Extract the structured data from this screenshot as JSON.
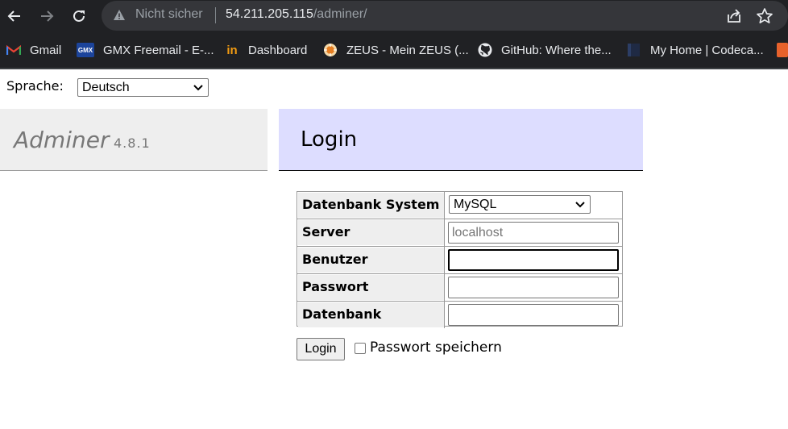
{
  "browser": {
    "security_text": "Nicht sicher",
    "url_host": "54.211.205.115",
    "url_path": "/adminer/",
    "bookmarks": [
      {
        "label": "Gmail",
        "icon": "gmail-icon"
      },
      {
        "label": "GMX Freemail - E-...",
        "icon": "gmx-icon",
        "icon_text": "GMX"
      },
      {
        "label": "Dashboard",
        "icon": "dashboard-icon",
        "icon_text": "in"
      },
      {
        "label": "ZEUS - Mein ZEUS (...",
        "icon": "zeus-icon"
      },
      {
        "label": "GitHub: Where the...",
        "icon": "github-icon"
      },
      {
        "label": "My Home | Codeca...",
        "icon": "codecademy-icon"
      }
    ]
  },
  "page": {
    "language_label": "Sprache:",
    "language_selected": "Deutsch",
    "brand": "Adminer",
    "version": "4.8.1",
    "title": "Login",
    "form": {
      "rows": [
        {
          "label": "Datenbank System",
          "value": "MySQL"
        },
        {
          "label": "Server",
          "placeholder": "localhost",
          "value": ""
        },
        {
          "label": "Benutzer",
          "value": ""
        },
        {
          "label": "Passwort",
          "value": ""
        },
        {
          "label": "Datenbank",
          "value": ""
        }
      ],
      "submit_label": "Login",
      "remember_label": "Passwort speichern",
      "remember_checked": false
    }
  },
  "colors": {
    "chrome_bg": "#202124",
    "omnibox_bg": "#35363a",
    "menu_bg": "#eeeeee",
    "content_head_bg": "#ddddff",
    "border": "#999999"
  }
}
